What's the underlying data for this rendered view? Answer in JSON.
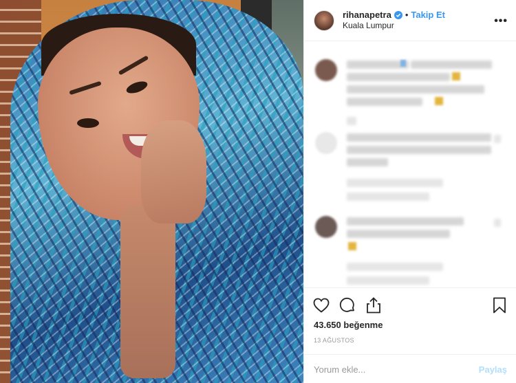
{
  "post": {
    "username": "rihanapetra",
    "follow_label": "Takip Et",
    "separator": "•",
    "location": "Kuala Lumpur",
    "more_label": "•••",
    "likes_text": "43.650 beğenme",
    "date_text": "13 AĞUSTOS"
  },
  "comment_box": {
    "placeholder": "Yorum ekle...",
    "share_label": "Paylaş"
  },
  "colors": {
    "link_blue": "#3897f0",
    "share_disabled": "#b2dffc",
    "verified_badge": "#3897f0"
  },
  "icons": {
    "verified": "verified-badge-icon",
    "more": "more-options-icon",
    "like": "heart-icon",
    "comment": "comment-bubble-icon",
    "share": "share-icon",
    "save": "bookmark-icon"
  }
}
